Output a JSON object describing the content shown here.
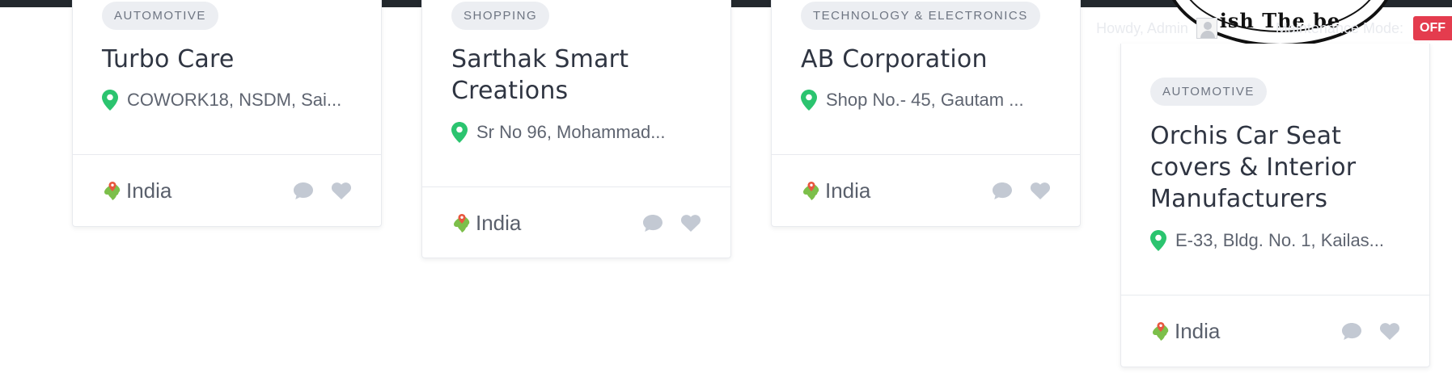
{
  "admin_bar": {
    "greeting": "Howdy, Admin",
    "maintenance_label": "Maintenance Mode:",
    "maintenance_state": "OFF"
  },
  "logo": {
    "partial_text": "ish The be"
  },
  "colors": {
    "pin": "#2bc46f",
    "badge_bg": "#eceef2",
    "icon_gray": "#c3c9d3",
    "off_badge": "#e43c4e"
  },
  "cards": [
    {
      "category": "AUTOMOTIVE",
      "title": "Turbo Care",
      "address": "COWORK18, NSDM, Sai...",
      "country": "India",
      "icons": [
        "map-pin-icon",
        "country-map-icon",
        "comment-icon",
        "heart-icon"
      ]
    },
    {
      "category": "SHOPPING",
      "title": "Sarthak Smart Creations",
      "address": "Sr No 96, Mohammad...",
      "country": "India",
      "icons": [
        "map-pin-icon",
        "country-map-icon",
        "comment-icon",
        "heart-icon"
      ]
    },
    {
      "category": "TECHNOLOGY & ELECTRONICS",
      "title": "AB Corporation",
      "address": "Shop No.- 45, Gautam ...",
      "country": "India",
      "icons": [
        "map-pin-icon",
        "country-map-icon",
        "comment-icon",
        "heart-icon"
      ]
    },
    {
      "category": "AUTOMOTIVE",
      "title": "Orchis Car Seat covers & Interior Manufacturers",
      "address": "E-33, Bldg. No. 1, Kailas...",
      "country": "India",
      "icons": [
        "map-pin-icon",
        "country-map-icon",
        "comment-icon",
        "heart-icon"
      ]
    }
  ]
}
